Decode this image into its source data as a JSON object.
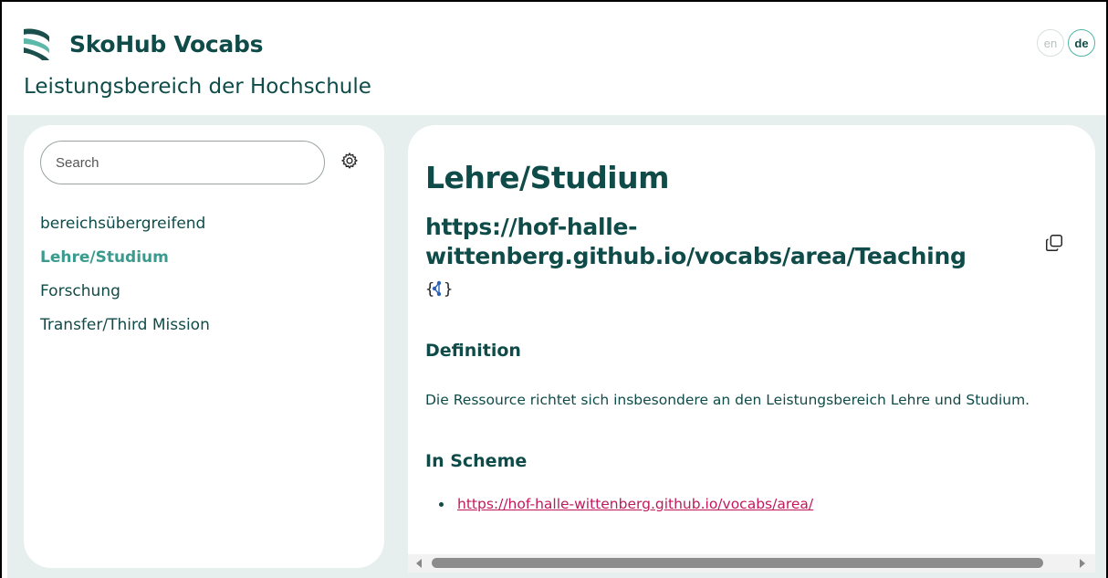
{
  "app": {
    "name": "SkoHub Vocabs",
    "logo_icon": "skohub-logo-icon",
    "brand_color": "#0f4b48",
    "accent_color": "#3b9a8e"
  },
  "languages": [
    {
      "code": "en",
      "active": false
    },
    {
      "code": "de",
      "active": true
    }
  ],
  "page_title": "Leistungsbereich der Hochschule",
  "sidebar": {
    "search": {
      "placeholder": "Search",
      "value": ""
    },
    "settings_icon": "gear-icon",
    "items": [
      {
        "label": "bereichsübergreifend",
        "active": false
      },
      {
        "label": "Lehre/Studium",
        "active": true
      },
      {
        "label": "Forschung",
        "active": false
      },
      {
        "label": "Transfer/Third Mission",
        "active": false
      }
    ]
  },
  "concept": {
    "title": "Lehre/Studium",
    "uri": "https://hof-halle-wittenberg.github.io/vocabs/area/Teaching",
    "copy_icon": "copy-icon",
    "json_icon": "json-ld-icon",
    "definition_heading": "Definition",
    "definition_text": "Die Ressource richtet sich insbesondere an den Leistungsbereich Lehre und Studium.",
    "in_scheme_heading": "In Scheme",
    "in_scheme_links": [
      "https://hof-halle-wittenberg.github.io/vocabs/area/"
    ],
    "link_color": "#c2185b"
  }
}
